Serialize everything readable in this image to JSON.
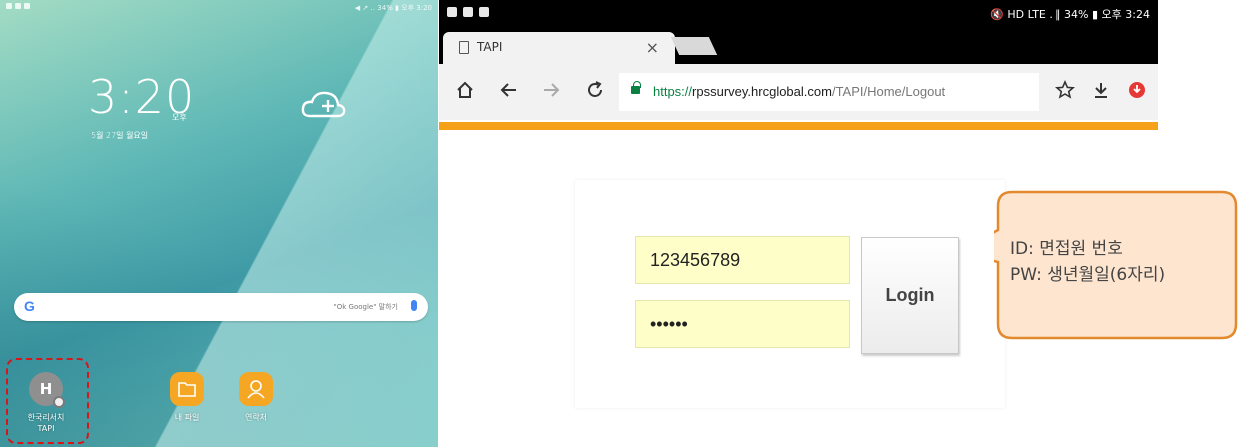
{
  "phone": {
    "status_right": "◀ ↗ ‥ 34% ▮ 오후 3:20",
    "clock_time": "3:20",
    "clock_ampm": "오후",
    "clock_date": "5월 27일 월요일",
    "search_logo": "G",
    "search_hint": "\"Ok Google\" 말하기",
    "apps": [
      {
        "label_line1": "한국리서치",
        "label_line2": "TAPI",
        "icon_letter": "H",
        "icon": "tapi-app-icon"
      },
      {
        "label_line1": "내 파일",
        "icon": "folder-icon"
      },
      {
        "label_line1": "연락처",
        "icon": "contacts-icon"
      }
    ],
    "highlight_color": "#d9141b"
  },
  "browser": {
    "status_right": "🔇 HD LTE . ∥ 34% ▮ 오후 3:24",
    "tab_title": "TAPI",
    "tab_close": "×",
    "url_scheme": "https://",
    "url_host": "rpssurvey.hrcglobal.com",
    "url_path": "/TAPI/Home/Logout",
    "icons": [
      "home-icon",
      "back-arrow-icon",
      "forward-arrow-icon",
      "reload-icon",
      "lock-icon",
      "star-icon",
      "download-icon",
      "adblock-icon"
    ],
    "accent_color": "#f5a11a"
  },
  "login": {
    "id_value": "123456789",
    "password_value": "••••••",
    "button_label": "Login"
  },
  "callout": {
    "line1": "ID: 면접원 번호",
    "line2": "PW: 생년월일(6자리)",
    "fill_color": "#fde5cf",
    "border_color": "#e38a2f"
  }
}
